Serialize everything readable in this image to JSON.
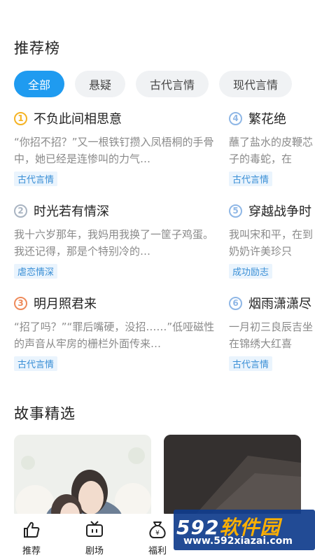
{
  "ranking": {
    "title": "推荐榜",
    "tabs": [
      "全部",
      "悬疑",
      "古代言情",
      "现代言情"
    ],
    "active_tab": "全部",
    "items": [
      {
        "rank": "1",
        "title": "不负此间相思意",
        "desc": "“你招不招？”又一根铁钉攒入凤梧桐的手骨中，她已经是连惨叫的力气…",
        "tag": "古代言情",
        "badge_color": "#f5b324"
      },
      {
        "rank": "2",
        "title": "时光若有情深",
        "desc": "我十六岁那年，我妈用我换了一筐子鸡蛋。我还记得，那是个特别冷的…",
        "tag": "虐恋情深",
        "badge_color": "#a9b4c2"
      },
      {
        "rank": "3",
        "title": "明月照君来",
        "desc": "“招了吗？”“罪后嘴硬，没招……”低哑磁性的声音从牢房的栅栏外面传来…",
        "tag": "古代言情",
        "badge_color": "#ee8a5a"
      },
      {
        "rank": "4",
        "title": "繁花绝",
        "desc": "蘸了盐水的皮鞭芯子的毒蛇，在",
        "tag": "古代言情",
        "badge_color": "#8fb7e6"
      },
      {
        "rank": "5",
        "title": "穿越战争时",
        "desc": "我叫宋和平，在到奶奶许美珍只",
        "tag": "成功励志",
        "badge_color": "#8fb7e6"
      },
      {
        "rank": "6",
        "title": "烟雨潇潇尽",
        "desc": "一月初三良辰吉坐在锦绣大红喜",
        "tag": "古代言情",
        "badge_color": "#8fb7e6"
      }
    ]
  },
  "stories": {
    "title": "故事精选"
  },
  "tabbar": {
    "items": [
      {
        "label": "推荐",
        "icon": "thumbs-up-icon"
      },
      {
        "label": "剧场",
        "icon": "tv-icon"
      },
      {
        "label": "福利",
        "icon": "money-bag-icon"
      }
    ]
  },
  "watermark": {
    "logo_num": "592",
    "logo_text": "软件园",
    "url": "www.592xiazai.com"
  },
  "colors": {
    "accent": "#1f9bf0",
    "tag_text": "#3a8fd6",
    "tag_bg": "#eaf4fd"
  }
}
